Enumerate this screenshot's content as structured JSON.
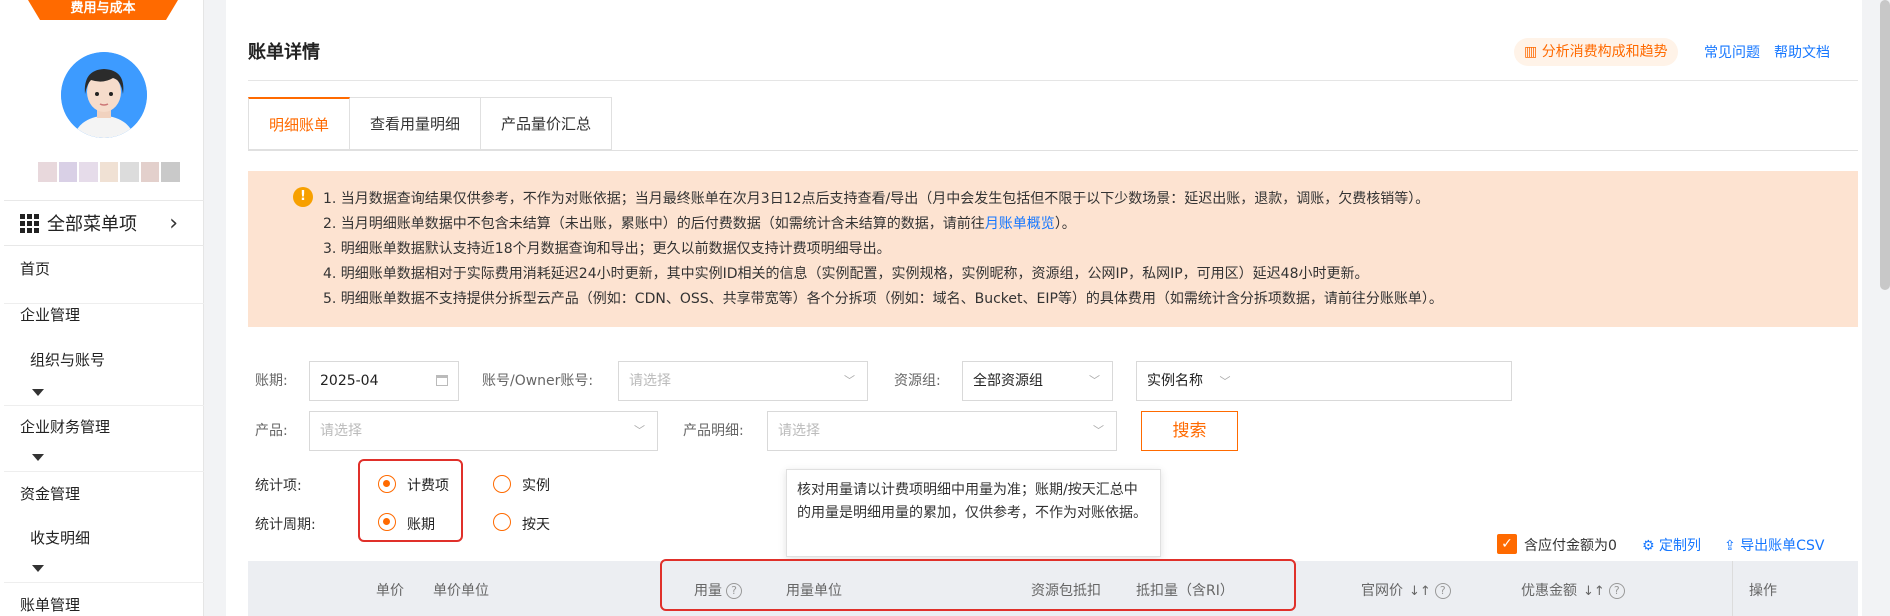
{
  "sidebar": {
    "brand_tab": "费用与成本",
    "all_menu": "全部菜单项",
    "items": [
      {
        "label": "首页",
        "level": 1
      },
      {
        "label": "企业管理",
        "level": 1
      },
      {
        "label": "组织与账号",
        "level": 2
      },
      {
        "label": "企业财务管理",
        "level": 1
      },
      {
        "label": "资金管理",
        "level": 1
      },
      {
        "label": "收支明细",
        "level": 2
      },
      {
        "label": "账单管理",
        "level": 1
      }
    ]
  },
  "header": {
    "title": "账单详情",
    "analyze_label": "分析消费构成和趋势",
    "faq_label": "常见问题",
    "help_label": "帮助文档"
  },
  "tabs": [
    {
      "label": "明细账单",
      "active": true
    },
    {
      "label": "查看用量明细",
      "active": false
    },
    {
      "label": "产品量价汇总",
      "active": false
    }
  ],
  "notice": {
    "line1": "1. 当月数据查询结果仅供参考，不作为对账依据；当月最终账单在次月3日12点后支持查看/导出（月中会发生包括但不限于以下少数场景：延迟出账，退款，调账，欠费核销等）。",
    "line2_pre": "2. 当月明细账单数据中不包含未结算（未出账，累账中）的后付费数据（如需统计含未结算的数据，请前往",
    "line2_link": "月账单概览",
    "line2_post": "）。",
    "line3": "3. 明细账单数据默认支持近18个月数据查询和导出；更久以前数据仅支持计费项明细导出。",
    "line4": "4. 明细账单数据相对于实际费用消耗延迟24小时更新，其中实例ID相关的信息（实例配置，实例规格，实例昵称，资源组，公网IP，私网IP，可用区）延迟48小时更新。",
    "line5": "5. 明细账单数据不支持提供分拆型云产品（例如：CDN、OSS、共享带宽等）各个分拆项（例如：域名、Bucket、EIP等）的具体费用（如需统计含分拆项数据，请前往分账账单）。"
  },
  "filters": {
    "period_label": "账期:",
    "period_value": "2025-04",
    "account_label": "账号/Owner账号:",
    "account_placeholder": "请选择",
    "resgroup_label": "资源组:",
    "resgroup_value": "全部资源组",
    "instance_value": "实例名称",
    "product_label": "产品:",
    "product_placeholder": "请选择",
    "product_detail_label": "产品明细:",
    "product_detail_placeholder": "请选择",
    "search_label": "搜索"
  },
  "stats": {
    "item_label": "统计项:",
    "item_opt1": "计费项",
    "item_opt2": "实例",
    "cycle_label": "统计周期:",
    "cycle_opt1": "账期",
    "cycle_opt2": "按天",
    "tooltip": "核对用量请以计费项明细中用量为准；账期/按天汇总中的用量是明细用量的累加，仅供参考，不作为对账依据。"
  },
  "toolbar": {
    "include_zero": "含应付金额为0",
    "custom_cols": "定制列",
    "export": "导出账单CSV"
  },
  "table": {
    "headers": [
      "单价",
      "单价单位",
      "用量",
      "用量单位",
      "资源包抵扣",
      "抵扣量（含RI）",
      "官网价",
      "优惠金额",
      "操作"
    ]
  },
  "colors": {
    "accent": "#ff6a00",
    "link": "#1677ff",
    "notice_bg": "#fde3d1",
    "highlight": "#e0302a"
  }
}
